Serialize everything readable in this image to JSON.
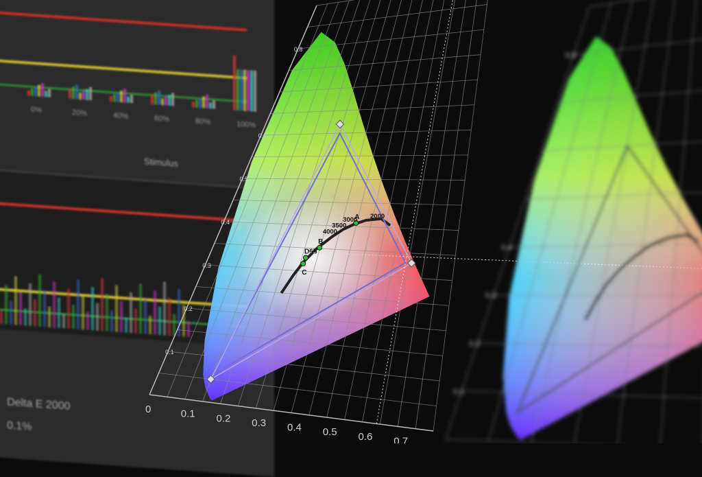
{
  "left_panel": {
    "histogram_top": {
      "tick_labels": [
        "0%",
        "20%",
        "40%",
        "60%",
        "80%",
        "100%"
      ],
      "axis_label": "Stimulus"
    },
    "histogram_bottom": {
      "caption_1": "Delta E 2000",
      "caption_2": "0.1%"
    }
  },
  "chart_data": [
    {
      "type": "scatter",
      "title": "",
      "xlabel": "",
      "ylabel": "",
      "x_ticks": [
        "0",
        "0.1",
        "0.2",
        "0.3",
        "0.4",
        "0.5",
        "0.6",
        "0.7"
      ],
      "y_ticks": [
        "0.1",
        "0.2",
        "0.3",
        "0.4",
        "0.5",
        "0.6",
        "0.8"
      ],
      "xlim": [
        0,
        0.8
      ],
      "ylim": [
        0,
        0.9
      ],
      "grid": true,
      "gamut_target": [
        [
          0.64,
          0.33
        ],
        [
          0.3,
          0.6
        ],
        [
          0.15,
          0.06
        ]
      ],
      "gamut_measured": [
        [
          0.66,
          0.33
        ],
        [
          0.29,
          0.62
        ],
        [
          0.15,
          0.05
        ]
      ],
      "white_points": [
        {
          "label": "D65",
          "x": 0.3127,
          "y": 0.329
        },
        {
          "label": "C",
          "x": 0.31,
          "y": 0.316
        },
        {
          "label": "B",
          "x": 0.348,
          "y": 0.352
        },
        {
          "label": "A",
          "x": 0.4476,
          "y": 0.4074
        }
      ],
      "planckian_labels": [
        {
          "label": "4000",
          "x": 0.38,
          "y": 0.377
        },
        {
          "label": "3500",
          "x": 0.405,
          "y": 0.391
        },
        {
          "label": "3000",
          "x": 0.437,
          "y": 0.404
        },
        {
          "label": "2000",
          "x": 0.527,
          "y": 0.413
        }
      ]
    },
    {
      "type": "scatter",
      "x_ticks": [],
      "y_ticks": [
        "0.1",
        "0.2",
        "0.3",
        "0.4",
        "0.8"
      ],
      "grid": true
    }
  ],
  "colors": {
    "grid": "#8a8a8a",
    "triangle_target": "#6f6fd6",
    "triangle_measured": "#b8a8e8",
    "locus_curve": "#222222",
    "white_point": "#2fbf3a"
  }
}
